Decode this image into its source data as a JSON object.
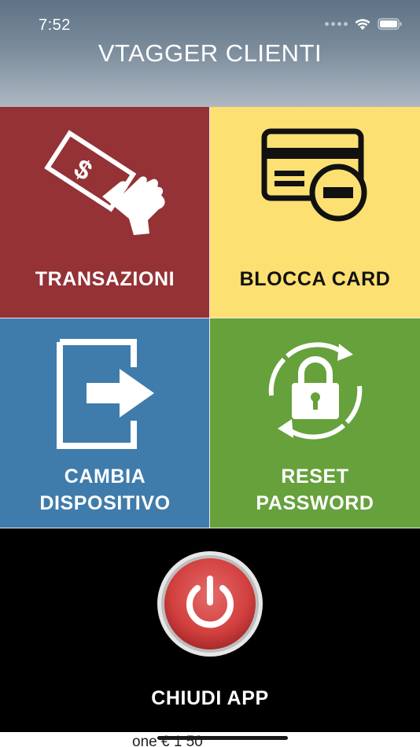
{
  "status_bar": {
    "time": "7:52",
    "icons": [
      "signal-dots-icon",
      "wifi-icon",
      "battery-icon"
    ]
  },
  "header": {
    "title": "VTAGGER CLIENTI",
    "colors": {
      "top": "#5f7385",
      "bottom": "#aeb8c2"
    }
  },
  "tiles": {
    "transazioni": {
      "label": "TRANSAZIONI",
      "icon": "hand-cash-icon",
      "color": "#943236"
    },
    "blocca_card": {
      "label": "BLOCCA CARD",
      "icon": "card-block-icon",
      "color": "#fce072"
    },
    "cambia_dispositivo": {
      "label_line1": "CAMBIA",
      "label_line2": "DISPOSITIVO",
      "icon": "exit-door-icon",
      "color": "#3f7cab"
    },
    "reset_password": {
      "label_line1": "RESET",
      "label_line2": "PASSWORD",
      "icon": "lock-refresh-icon",
      "color": "#66a13c"
    },
    "chiudi_app": {
      "label": "CHIUDI APP",
      "icon": "power-button-icon",
      "color": "#000000"
    }
  },
  "bottom": {
    "partial_text": "one    € 1 50"
  }
}
